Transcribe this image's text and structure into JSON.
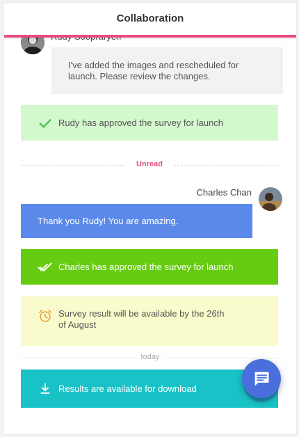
{
  "header": {
    "title": "Collaboration"
  },
  "messages": [
    {
      "sender": "Rudy Soopraryen",
      "text": "I've added the images and rescheduled for launch. Please review the changes."
    },
    {
      "sender": "Charles Chan",
      "text": "Thank you Rudy! You are amazing."
    }
  ],
  "banners": {
    "rudy_approved": "Rudy has approved the survey for launch",
    "charles_approved": "Charles has approved the survey for launch",
    "survey_result": "Survey result will be available by the 26th of August",
    "results_download": "Results are available for download"
  },
  "dividers": {
    "unread": "Unread",
    "today": "today"
  },
  "icons": {
    "rudy_approved": "check-icon",
    "charles_approved": "double-check-icon",
    "survey_result": "alarm-clock-icon",
    "results_download": "download-icon",
    "fab": "chat-icon"
  },
  "colors": {
    "accent": "#e54d80",
    "approved_light_bg": "#d4f8cd",
    "approved_light_icon": "#4fc24f",
    "approved_dark_bg": "#66cc11",
    "own_message_bg": "#5b89ea",
    "info_bg": "#fafbcc",
    "info_icon": "#e8a33a",
    "download_bg": "#19c2c6",
    "fab_bg": "#4a6fdc"
  }
}
